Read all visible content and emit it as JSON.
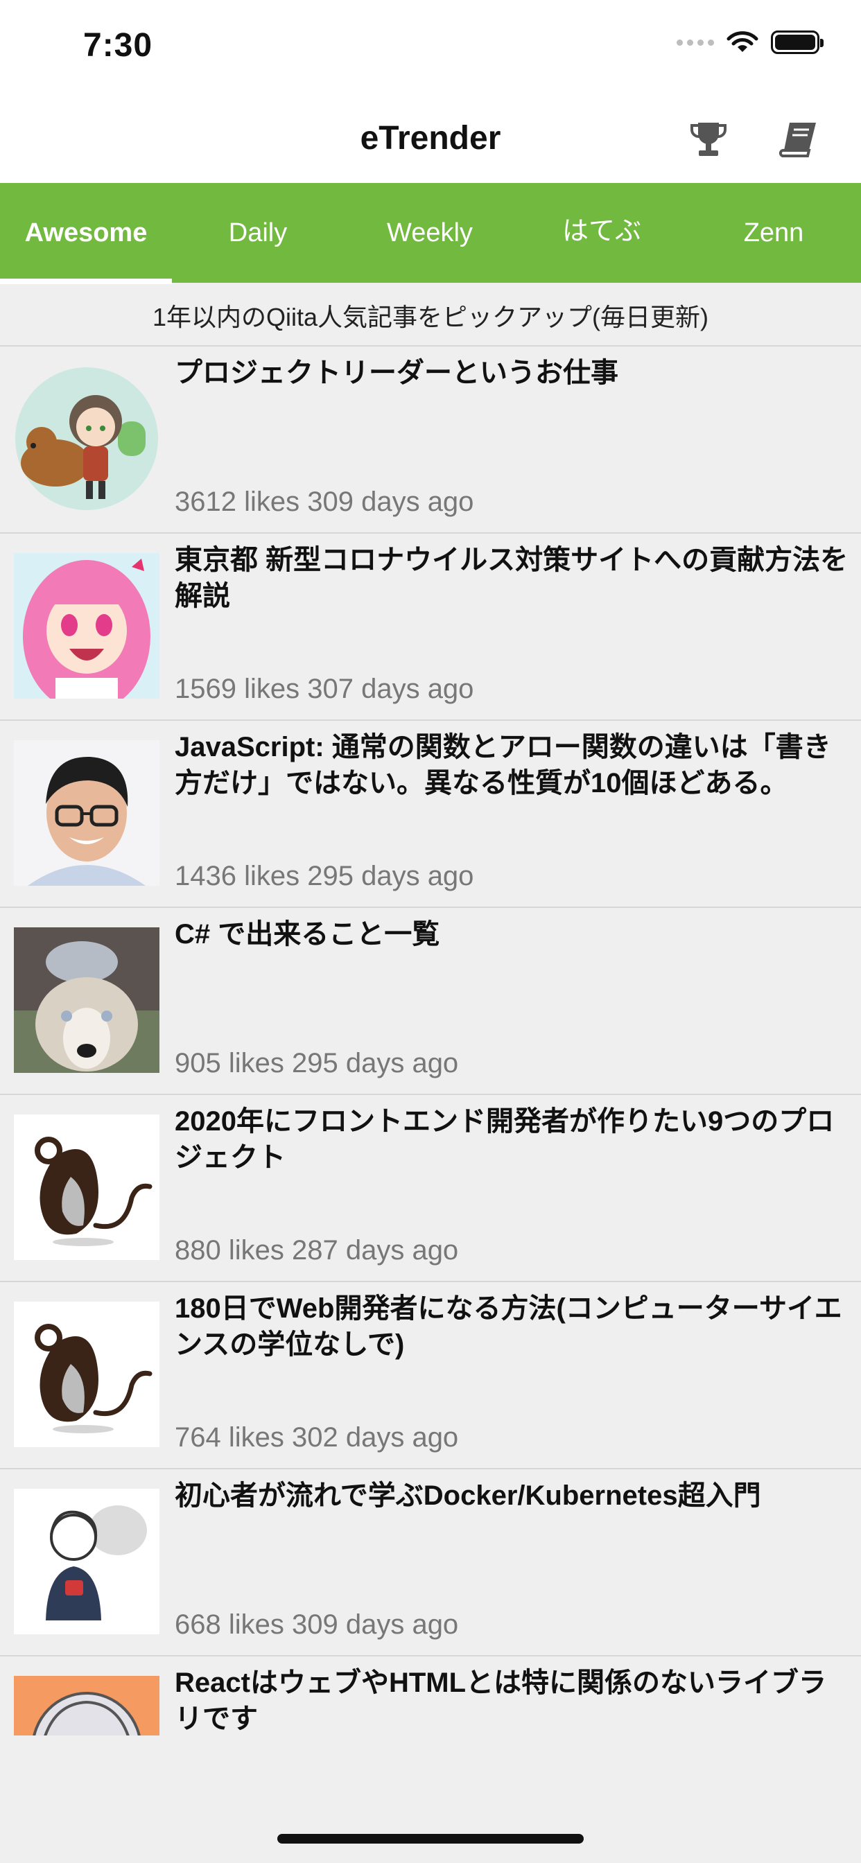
{
  "status_bar": {
    "time": "7:30"
  },
  "nav": {
    "title": "eTrender",
    "trophy_icon": "trophy-icon",
    "book_icon": "book-icon"
  },
  "tabs": [
    {
      "label": "Awesome",
      "active": true
    },
    {
      "label": "Daily",
      "active": false
    },
    {
      "label": "Weekly",
      "active": false
    },
    {
      "label": "はてぶ",
      "active": false
    },
    {
      "label": "Zenn",
      "active": false
    }
  ],
  "subtitle": "1年以内のQiita人気記事をピックアップ(毎日更新)",
  "articles": [
    {
      "title": "プロジェクトリーダーというお仕事",
      "meta": "3612 likes 309 days ago",
      "avatar": "anime-girl-with-bear"
    },
    {
      "title": "東京都 新型コロナウイルス対策サイトへの貢献方法を解説",
      "meta": "1569 likes 307 days ago",
      "avatar": "pink-hair-anime"
    },
    {
      "title": "JavaScript: 通常の関数とアロー関数の違いは「書き方だけ」ではない。異なる性質が10個ほどある。",
      "meta": "1436 likes 295 days ago",
      "avatar": "man-with-glasses"
    },
    {
      "title": "C# で出来ること一覧",
      "meta": "905 likes 295 days ago",
      "avatar": "dog-with-plush"
    },
    {
      "title": "2020年にフロントエンド開発者が作りたい9つのプロジェクト",
      "meta": "880 likes 287 days ago",
      "avatar": "rat-logo"
    },
    {
      "title": "180日でWeb開発者になる方法(コンピューターサイエンスの学位なしで)",
      "meta": "764 likes 302 days ago",
      "avatar": "rat-logo"
    },
    {
      "title": "初心者が流れで学ぶDocker/Kubernetes超入門",
      "meta": "668 likes 309 days ago",
      "avatar": "sketch-person-with-cup"
    },
    {
      "title": "ReactはウェブやHTMLとは特に関係のないライブラリです",
      "meta": "",
      "avatar": "orange-anime"
    }
  ],
  "colors": {
    "accent": "#72b93f",
    "background": "#efefef",
    "meta_text": "#777777"
  }
}
